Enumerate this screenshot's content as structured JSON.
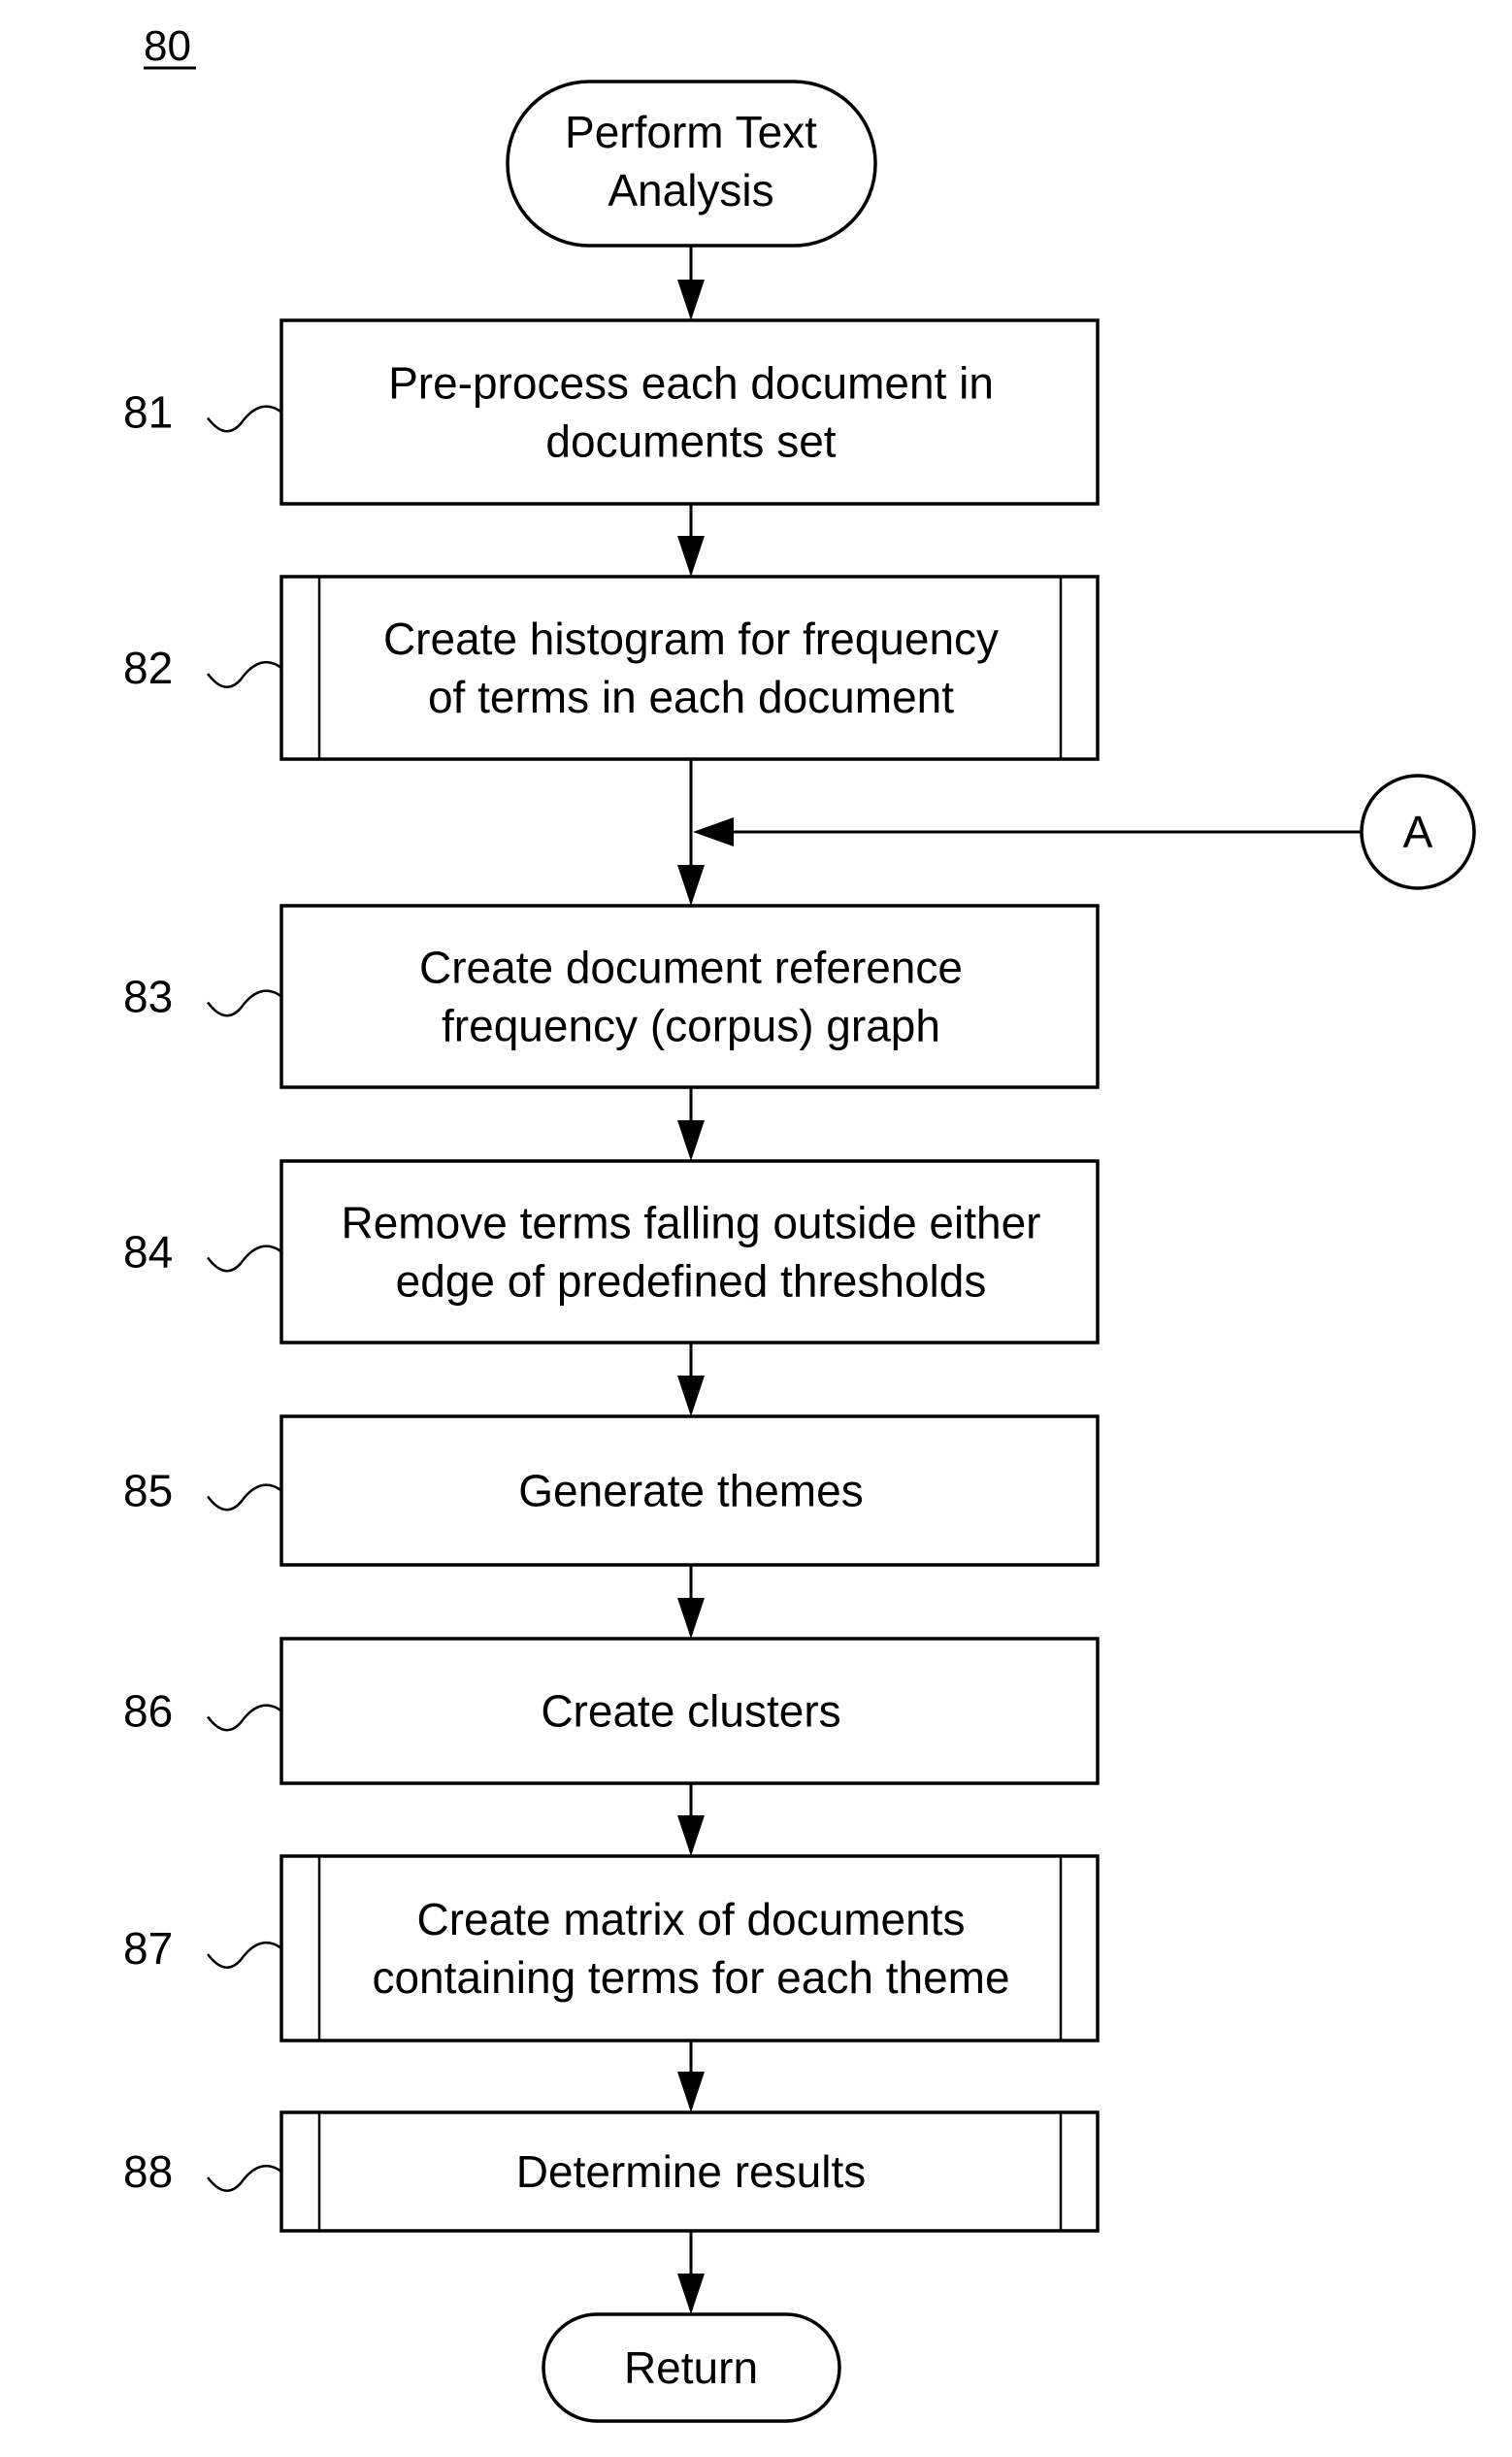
{
  "figure": {
    "number": "80"
  },
  "start": {
    "label_lines": [
      "Perform Text",
      "Analysis"
    ]
  },
  "steps": [
    {
      "ref": "81",
      "type": "process",
      "lines": [
        "Pre-process each document in",
        "documents set"
      ]
    },
    {
      "ref": "82",
      "type": "subroutine",
      "lines": [
        "Create histogram for frequency",
        "of terms in each document"
      ]
    },
    {
      "ref": "83",
      "type": "process",
      "lines": [
        "Create document reference",
        "frequency (corpus) graph"
      ]
    },
    {
      "ref": "84",
      "type": "process",
      "lines": [
        "Remove terms falling outside either",
        "edge of predefined thresholds"
      ]
    },
    {
      "ref": "85",
      "type": "process",
      "lines": [
        "Generate themes"
      ]
    },
    {
      "ref": "86",
      "type": "process",
      "lines": [
        "Create clusters"
      ]
    },
    {
      "ref": "87",
      "type": "subroutine",
      "lines": [
        "Create matrix of documents",
        "containing terms for each theme"
      ]
    },
    {
      "ref": "88",
      "type": "subroutine",
      "lines": [
        "Determine results"
      ]
    }
  ],
  "connector": {
    "label": "A",
    "joins_before_step": "83"
  },
  "end": {
    "label_lines": [
      "Return"
    ]
  }
}
